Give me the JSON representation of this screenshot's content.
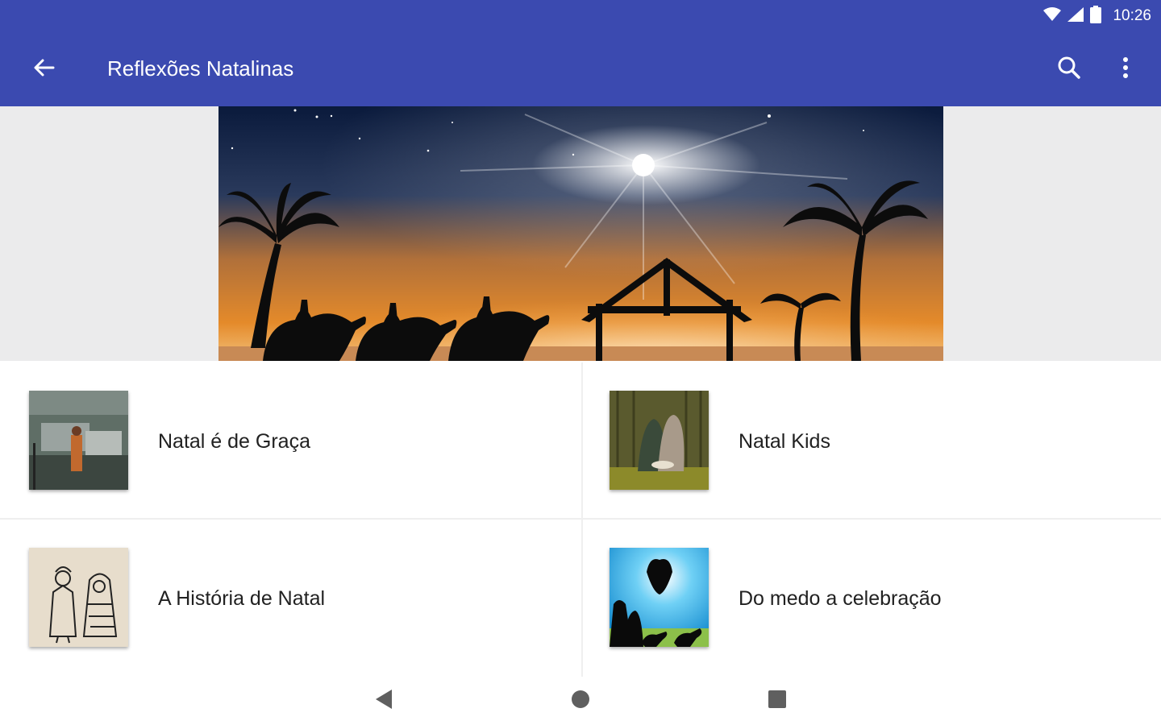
{
  "status_bar": {
    "time": "10:26",
    "icons": [
      "wifi-icon",
      "cell-signal-icon",
      "battery-icon"
    ]
  },
  "toolbar": {
    "title": "Reflexões Natalinas",
    "back_icon": "arrow-back-icon",
    "search_icon": "search-icon",
    "overflow_icon": "more-vert-icon"
  },
  "hero": {
    "image": "nativity-scene-banner"
  },
  "items": [
    {
      "label": "Natal é de Graça",
      "thumbnail": "street-scene-thumbnail"
    },
    {
      "label": "Natal Kids",
      "thumbnail": "nativity-cartoon-thumbnail"
    },
    {
      "label": "A História de Natal",
      "thumbnail": "sketch-figures-thumbnail"
    },
    {
      "label": "Do medo a celebração",
      "thumbnail": "angel-shepherds-thumbnail"
    }
  ],
  "nav_bar": {
    "back": "nav-back-icon",
    "home": "nav-home-icon",
    "recents": "nav-recents-icon"
  },
  "colors": {
    "primary": "#3b4ab0",
    "surface": "#ffffff",
    "hero_bg": "#ebebec",
    "text": "#212121"
  }
}
